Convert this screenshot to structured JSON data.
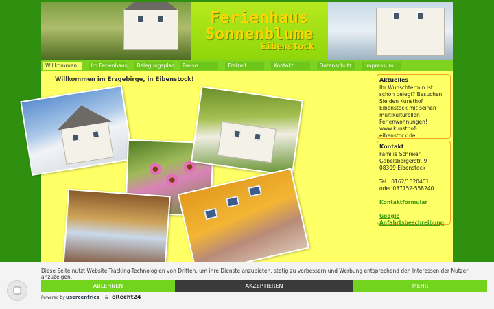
{
  "header": {
    "logo_line1": "Ferienhaus",
    "logo_line2": "Sonnenblume",
    "logo_line3": "Eibenstock"
  },
  "nav": {
    "items": [
      {
        "label": "Willkommen",
        "active": true
      },
      {
        "label": "Im Ferienhaus",
        "active": false
      },
      {
        "label": "Belegungsplan",
        "active": false
      },
      {
        "label": "Preise",
        "active": false
      },
      {
        "label": "Freizeit",
        "active": false
      },
      {
        "label": "Kontakt",
        "active": false
      },
      {
        "label": "Datenschutz",
        "active": false
      },
      {
        "label": "Impressum",
        "active": false
      }
    ]
  },
  "main": {
    "welcome": "Willkommen im Erzgebirge, in Eibenstock!"
  },
  "sidebar": {
    "news": {
      "title": "Aktuelles",
      "text": "Ihr Wunschtermin ist schon belegt? Besuchen Sie den Kunsthof Eibenstock mit seinen multikulturellen Ferienwohnungen! www.kunsthof-eibenstock.de"
    },
    "contact": {
      "title": "Kontakt",
      "line1": "Familie Schreier",
      "line2": "Gabelsbergerstr. 9",
      "line3": "08309 Eibenstock",
      "phone1": "Tel.: 0162/1020401",
      "phone2": "oder 037752-558240",
      "form_link": "Kontaktformular",
      "map_link": "Google Anfahrtsbeschreibung"
    }
  },
  "cookie_banner": {
    "text": "Diese Seite nutzt Website-Tracking-Technologien von Dritten, um ihre Dienste anzubieten, stetig zu verbessern und Werbung entsprechend den Interessen der Nutzer anzuzeigen.",
    "deny_label": "ABLEHNEN",
    "accept_label": "AKZEPTIEREN",
    "more_label": "MEHR",
    "powered_by": "Powered by",
    "usercentrics": "usercentrics",
    "amp": "&",
    "erecht": "eRecht24"
  },
  "colors": {
    "page_bg": "#2f8f0e",
    "nav_bg": "#7ed321",
    "content_bg": "#ffff66",
    "logo_text": "#ffd400",
    "link": "#3a9e10",
    "accept_btn": "#3a3a3a",
    "deny_btn": "#72d41d"
  }
}
